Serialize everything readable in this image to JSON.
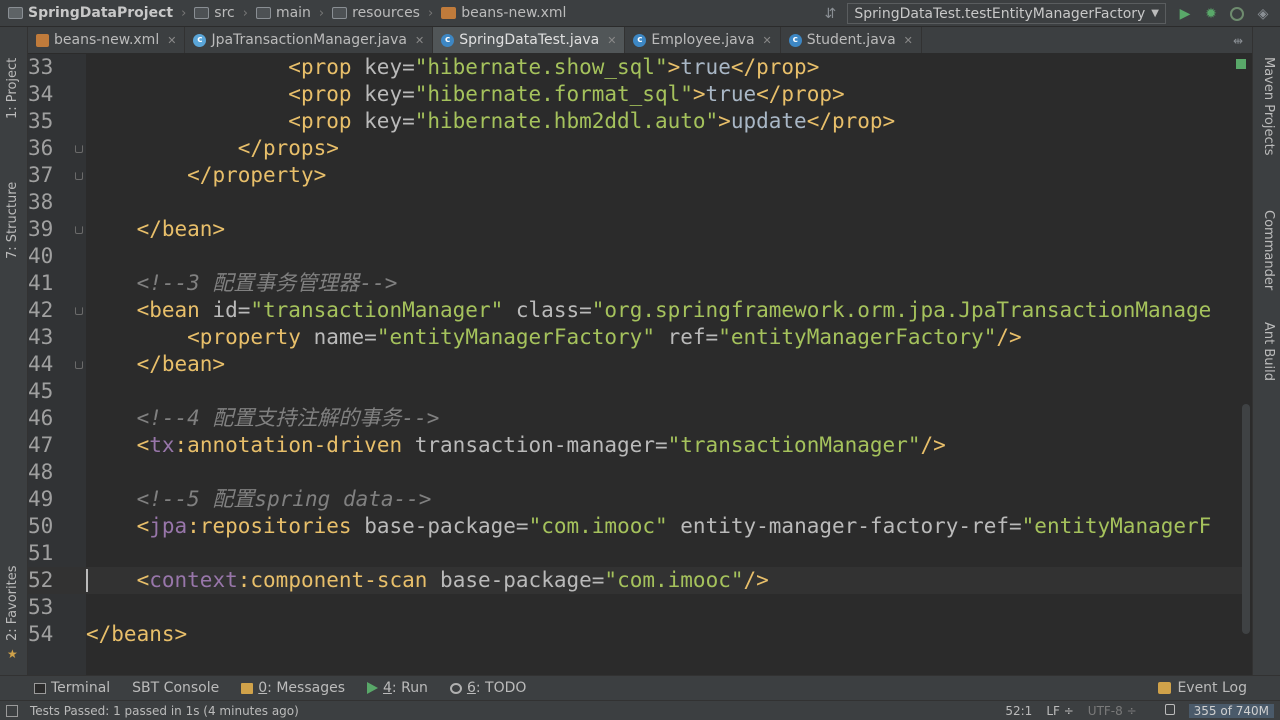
{
  "navbar": {
    "breadcrumbs": [
      "SpringDataProject",
      "src",
      "main",
      "resources",
      "beans-new.xml"
    ],
    "run_config": "SpringDataTest.testEntityManagerFactory"
  },
  "tabs": [
    {
      "label": "beans-new.xml",
      "icon": "xml-file-icon",
      "active": false
    },
    {
      "label": "JpaTransactionManager.java",
      "icon": "java-class-icon",
      "active": false
    },
    {
      "label": "SpringDataTest.java",
      "icon": "java-class-icon",
      "active": true
    },
    {
      "label": "Employee.java",
      "icon": "java-class-icon",
      "active": false
    },
    {
      "label": "Student.java",
      "icon": "java-class-icon",
      "active": false
    }
  ],
  "left_stripe": {
    "project": "1: Project",
    "structure": "7: Structure",
    "favorites": "2: Favorites"
  },
  "right_stripe": {
    "maven": "Maven Projects",
    "commander": "Commander",
    "ant": "Ant Build"
  },
  "editor": {
    "lines": [
      {
        "n": "33",
        "tokens": [
          [
            "",
            "                "
          ],
          [
            "t",
            "<prop "
          ],
          [
            "a",
            "key="
          ],
          [
            "v",
            "\"hibernate.show_sql\""
          ],
          [
            "t",
            ">"
          ],
          [
            "x",
            "true"
          ],
          [
            "t",
            "</prop>"
          ]
        ]
      },
      {
        "n": "34",
        "tokens": [
          [
            "",
            "                "
          ],
          [
            "t",
            "<prop "
          ],
          [
            "a",
            "key="
          ],
          [
            "v",
            "\"hibernate.format_sql\""
          ],
          [
            "t",
            ">"
          ],
          [
            "x",
            "true"
          ],
          [
            "t",
            "</prop>"
          ]
        ]
      },
      {
        "n": "35",
        "tokens": [
          [
            "",
            "                "
          ],
          [
            "t",
            "<prop "
          ],
          [
            "a",
            "key="
          ],
          [
            "v",
            "\"hibernate.hbm2ddl.auto\""
          ],
          [
            "t",
            ">"
          ],
          [
            "x",
            "update"
          ],
          [
            "t",
            "</prop>"
          ]
        ]
      },
      {
        "n": "36",
        "tokens": [
          [
            "",
            "            "
          ],
          [
            "t",
            "</props>"
          ]
        ]
      },
      {
        "n": "37",
        "tokens": [
          [
            "",
            "        "
          ],
          [
            "t",
            "</property>"
          ]
        ]
      },
      {
        "n": "38",
        "tokens": []
      },
      {
        "n": "39",
        "tokens": [
          [
            "",
            "    "
          ],
          [
            "t",
            "</bean>"
          ]
        ]
      },
      {
        "n": "40",
        "tokens": []
      },
      {
        "n": "41",
        "tokens": [
          [
            "",
            "    "
          ],
          [
            "cm",
            "<!--3 配置事务管理器-->"
          ]
        ]
      },
      {
        "n": "42",
        "tokens": [
          [
            "",
            "    "
          ],
          [
            "t",
            "<bean "
          ],
          [
            "a",
            "id="
          ],
          [
            "v",
            "\"transactionManager\""
          ],
          [
            "a",
            " class="
          ],
          [
            "v",
            "\"org.springframework.orm.jpa.JpaTransactionManage"
          ]
        ]
      },
      {
        "n": "43",
        "tokens": [
          [
            "",
            "        "
          ],
          [
            "t",
            "<property "
          ],
          [
            "a",
            "name="
          ],
          [
            "v",
            "\"entityManagerFactory\""
          ],
          [
            "a",
            " ref="
          ],
          [
            "v",
            "\"entityManagerFactory\""
          ],
          [
            "t",
            "/>"
          ]
        ]
      },
      {
        "n": "44",
        "tokens": [
          [
            "",
            "    "
          ],
          [
            "t",
            "</bean>"
          ]
        ]
      },
      {
        "n": "45",
        "tokens": []
      },
      {
        "n": "46",
        "tokens": [
          [
            "",
            "    "
          ],
          [
            "cm",
            "<!--4 配置支持注解的事务-->"
          ]
        ]
      },
      {
        "n": "47",
        "tokens": [
          [
            "",
            "    "
          ],
          [
            "t",
            "<"
          ],
          [
            "ns",
            "tx"
          ],
          [
            "t",
            ":annotation-driven "
          ],
          [
            "a",
            "transaction-manager="
          ],
          [
            "v",
            "\"transactionManager\""
          ],
          [
            "t",
            "/>"
          ]
        ]
      },
      {
        "n": "48",
        "tokens": []
      },
      {
        "n": "49",
        "tokens": [
          [
            "",
            "    "
          ],
          [
            "cm",
            "<!--5 配置spring data-->"
          ]
        ]
      },
      {
        "n": "50",
        "tokens": [
          [
            "",
            "    "
          ],
          [
            "t",
            "<"
          ],
          [
            "ns",
            "jpa"
          ],
          [
            "t",
            ":repositories "
          ],
          [
            "a",
            "base-package="
          ],
          [
            "v",
            "\"com.imooc\""
          ],
          [
            "a",
            " entity-manager-factory-ref="
          ],
          [
            "v",
            "\"entityManagerF"
          ]
        ]
      },
      {
        "n": "51",
        "tokens": []
      },
      {
        "n": "52",
        "tokens": [
          [
            "",
            "    "
          ],
          [
            "t",
            "<"
          ],
          [
            "ns",
            "context"
          ],
          [
            "t",
            ":component-scan "
          ],
          [
            "a",
            "base-package="
          ],
          [
            "v",
            "\"com.imooc\""
          ],
          [
            "t",
            "/>"
          ]
        ]
      },
      {
        "n": "53",
        "tokens": []
      },
      {
        "n": "54",
        "tokens": [
          [
            "t",
            "</beans>"
          ]
        ]
      }
    ]
  },
  "toolwindows": {
    "terminal": "Terminal",
    "sbt": "SBT Console",
    "messages_num": "0",
    "messages": ": Messages",
    "run_num": "4",
    "run": ": Run",
    "todo_num": "6",
    "todo": ": TODO",
    "event_log": "Event Log"
  },
  "status": {
    "message": "Tests Passed: 1 passed in 1s (4 minutes ago)",
    "position": "52:1",
    "line_sep": "LF ÷",
    "encoding": "UTF-8 ÷",
    "memory": "355 of 740M"
  },
  "colors": {
    "tag": "#e8bf6a",
    "attr": "#bababa",
    "value": "#a5c25c",
    "text": "#a9b7c6",
    "namespace": "#9876aa",
    "comment": "#808080"
  }
}
